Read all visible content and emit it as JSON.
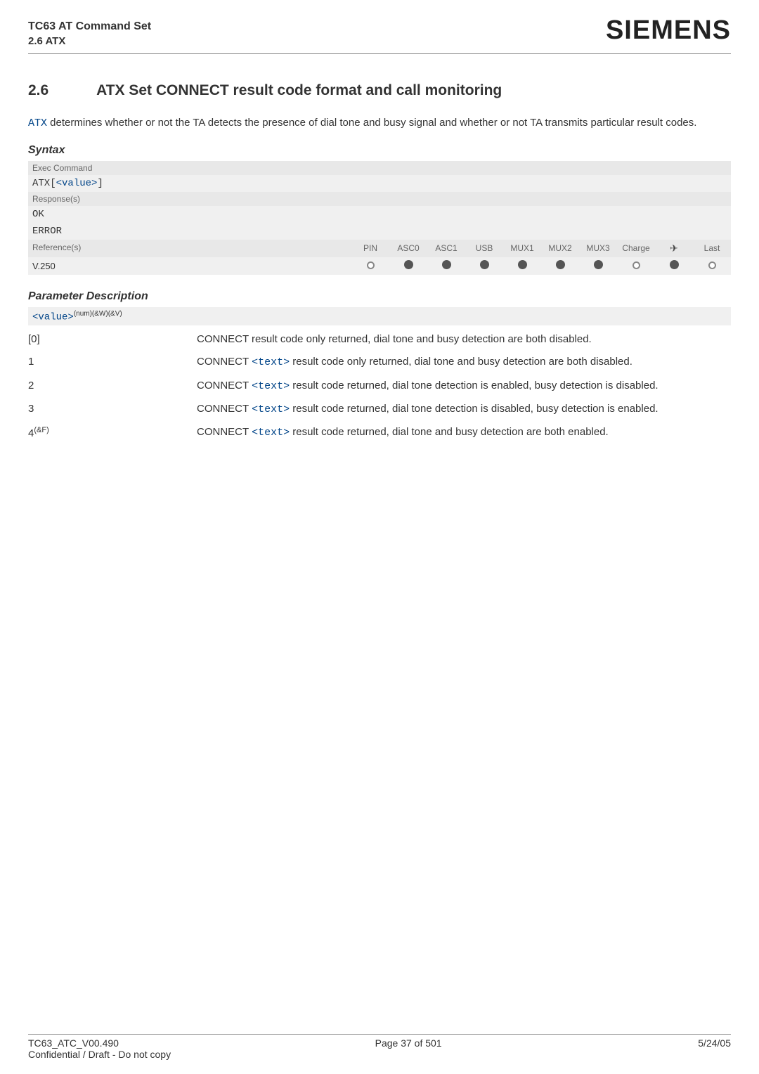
{
  "header": {
    "title": "TC63 AT Command Set",
    "subsection": "2.6 ATX",
    "logo": "SIEMENS"
  },
  "section": {
    "number": "2.6",
    "title": "ATX   Set CONNECT result code format and call monitoring"
  },
  "intro": {
    "cmd": "ATX",
    "text_after": " determines whether or not the TA detects the presence of dial tone and busy signal and whether or not TA transmits particular result codes."
  },
  "syntax_label": "Syntax",
  "syntax": {
    "exec_label": "Exec Command",
    "exec_cmd_prefix": "ATX",
    "exec_cmd_value": "<value>",
    "response_label": "Response(s)",
    "response_ok": "OK",
    "response_error": "ERROR",
    "references_label": "Reference(s)",
    "ref_value": "V.250",
    "columns": [
      "PIN",
      "ASC0",
      "ASC1",
      "USB",
      "MUX1",
      "MUX2",
      "MUX3",
      "Charge",
      "",
      "Last"
    ]
  },
  "param_label": "Parameter Description",
  "param_header": {
    "name": "<value>",
    "sup": "(num)(&W)(&V)"
  },
  "params": [
    {
      "key": "[0]",
      "text_before": "CONNECT result code only returned, dial tone and busy detection are both disabled.",
      "has_text_link": false
    },
    {
      "key": "1",
      "text": "CONNECT ",
      "link": "<text>",
      "after": " result code only returned, dial tone and busy detection are both disabled."
    },
    {
      "key": "2",
      "text": "CONNECT ",
      "link": "<text>",
      "after": " result code returned, dial tone detection is enabled, busy detection is disabled."
    },
    {
      "key": "3",
      "text": "CONNECT ",
      "link": "<text>",
      "after": " result code returned, dial tone detection is disabled, busy detection is enabled."
    },
    {
      "key": "4",
      "key_sup": "(&F)",
      "text": "CONNECT ",
      "link": "<text>",
      "after": " result code returned, dial tone and busy detection are both enabled."
    }
  ],
  "footer": {
    "left1": "TC63_ATC_V00.490",
    "left2": "Confidential / Draft - Do not copy",
    "center": "Page 37 of 501",
    "right": "5/24/05"
  }
}
